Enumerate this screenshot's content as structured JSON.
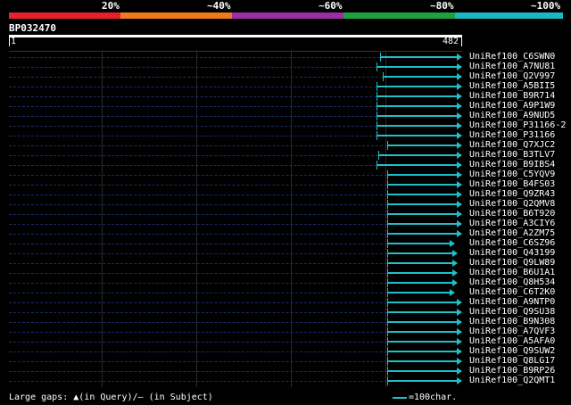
{
  "scale": {
    "labels": [
      "20%",
      "~40%",
      "~60%",
      "~80%",
      "~100%"
    ],
    "colors": [
      "#e8202c",
      "#ee7a1c",
      "#9b2ea0",
      "#20a040",
      "#1ab8c4"
    ]
  },
  "query": {
    "name": "BP032470",
    "start": "1",
    "end": "482",
    "length": 482
  },
  "hits": [
    {
      "label": "UniRef100_C6SWN0",
      "start": 395,
      "end": 482
    },
    {
      "label": "UniRef100_A7NU81",
      "start": 391,
      "end": 482
    },
    {
      "label": "UniRef100_Q2V997",
      "start": 398,
      "end": 482
    },
    {
      "label": "UniRef100_A5BII5",
      "start": 391,
      "end": 482
    },
    {
      "label": "UniRef100_B9R714",
      "start": 391,
      "end": 482
    },
    {
      "label": "UniRef100_A9P1W9",
      "start": 391,
      "end": 482
    },
    {
      "label": "UniRef100_A9NUD5",
      "start": 391,
      "end": 482
    },
    {
      "label": "UniRef100_P31166-2",
      "start": 391,
      "end": 482
    },
    {
      "label": "UniRef100_P31166",
      "start": 391,
      "end": 482
    },
    {
      "label": "UniRef100_Q7XJC2",
      "start": 402,
      "end": 482
    },
    {
      "label": "UniRef100_B3TLV7",
      "start": 393,
      "end": 482
    },
    {
      "label": "UniRef100_B9IBS4",
      "start": 391,
      "end": 482
    },
    {
      "label": "UniRef100_C5YQV9",
      "start": 402,
      "end": 482
    },
    {
      "label": "UniRef100_B4FS03",
      "start": 402,
      "end": 482
    },
    {
      "label": "UniRef100_Q9ZR43",
      "start": 402,
      "end": 482
    },
    {
      "label": "UniRef100_Q2QMV8",
      "start": 402,
      "end": 482
    },
    {
      "label": "UniRef100_B6T920",
      "start": 402,
      "end": 482
    },
    {
      "label": "UniRef100_A3CIY6",
      "start": 402,
      "end": 482
    },
    {
      "label": "UniRef100_A2ZM75",
      "start": 402,
      "end": 482
    },
    {
      "label": "UniRef100_C6SZ96",
      "start": 402,
      "end": 474
    },
    {
      "label": "UniRef100_Q43199",
      "start": 402,
      "end": 477
    },
    {
      "label": "UniRef100_Q9LW89",
      "start": 402,
      "end": 477
    },
    {
      "label": "UniRef100_B6U1A1",
      "start": 402,
      "end": 477
    },
    {
      "label": "UniRef100_Q8H534",
      "start": 402,
      "end": 477
    },
    {
      "label": "UniRef100_C6T2K0",
      "start": 402,
      "end": 474
    },
    {
      "label": "UniRef100_A9NTP0",
      "start": 402,
      "end": 482
    },
    {
      "label": "UniRef100_Q9SU38",
      "start": 402,
      "end": 482
    },
    {
      "label": "UniRef100_B9N308",
      "start": 402,
      "end": 482
    },
    {
      "label": "UniRef100_A7QVF3",
      "start": 402,
      "end": 482
    },
    {
      "label": "UniRef100_A5AFA0",
      "start": 402,
      "end": 482
    },
    {
      "label": "UniRef100_Q9SUW2",
      "start": 402,
      "end": 482
    },
    {
      "label": "UniRef100_Q8LG17",
      "start": 402,
      "end": 482
    },
    {
      "label": "UniRef100_B9RP26",
      "start": 402,
      "end": 482
    },
    {
      "label": "UniRef100_Q2QMT1",
      "start": 402,
      "end": 482
    }
  ],
  "footer": {
    "gaps_prefix": "Large gaps: ",
    "gaps_query_symbol": "▲",
    "gaps_query_text": "(in Query)/",
    "gaps_subject_symbol": "–",
    "gaps_subject_text": " (in Subject)",
    "legend_text": "=100char."
  }
}
